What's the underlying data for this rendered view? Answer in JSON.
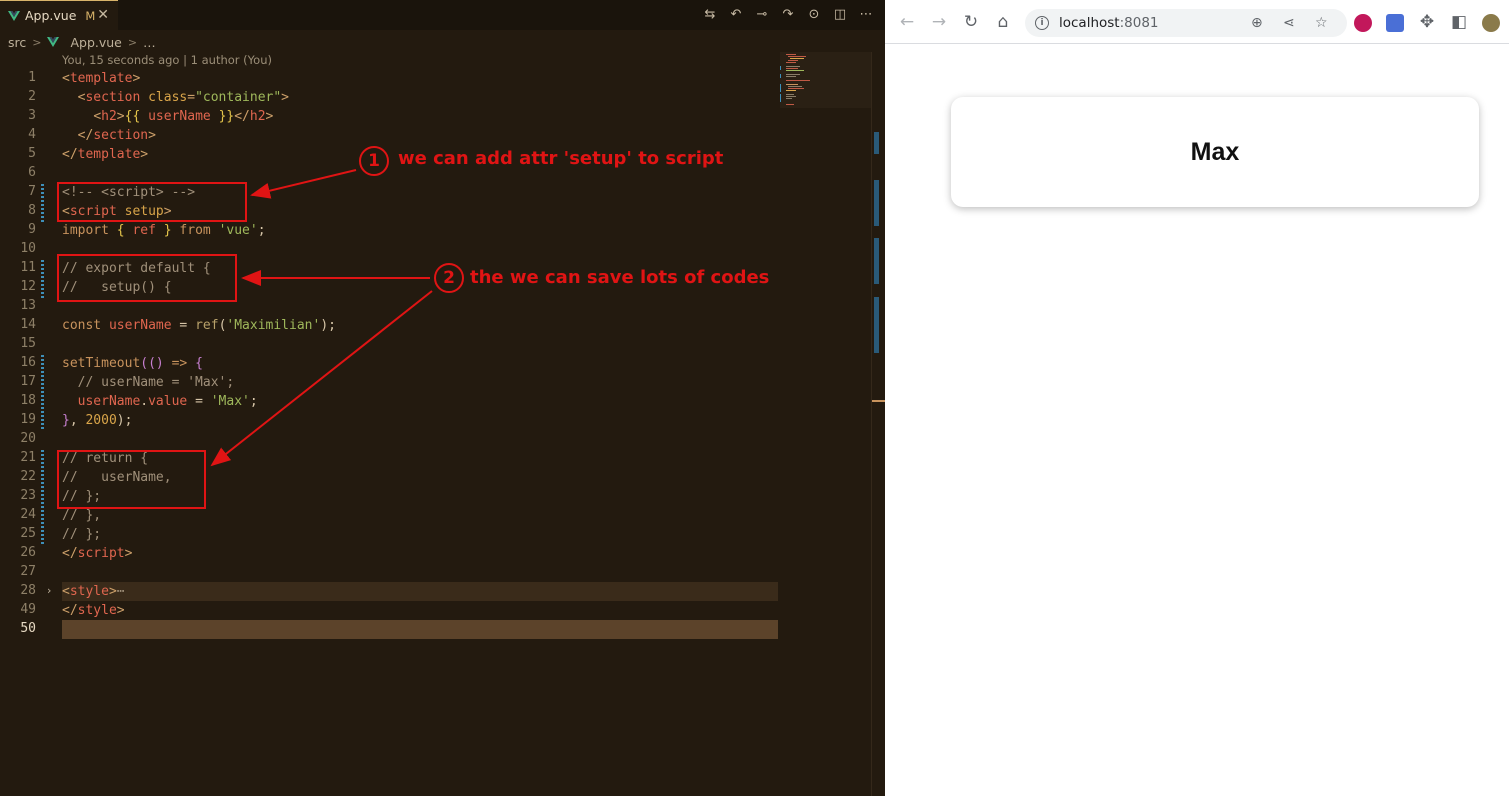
{
  "editor": {
    "tab": {
      "filename": "App.vue",
      "status": "M"
    },
    "toolbar_icons": [
      "source-control-icon",
      "go-back-icon",
      "commit-icon",
      "go-forward-icon",
      "timeline-icon",
      "split-editor-icon",
      "more-icon"
    ],
    "breadcrumb": {
      "folder": "src",
      "file": "App.vue",
      "ellipsis": "…"
    },
    "blame": "You, 15 seconds ago | 1 author (You)",
    "line_numbers": [
      "1",
      "2",
      "3",
      "4",
      "5",
      "6",
      "7",
      "8",
      "9",
      "10",
      "11",
      "12",
      "13",
      "14",
      "15",
      "16",
      "17",
      "18",
      "19",
      "20",
      "21",
      "22",
      "23",
      "24",
      "25",
      "26",
      "27",
      "28",
      "49",
      "50"
    ],
    "active_line": "50"
  },
  "annotations": {
    "one": {
      "number": "1",
      "text": "we can add attr 'setup' to script"
    },
    "two": {
      "number": "2",
      "text": "the we can save lots of codes"
    },
    "color": "#e01414"
  },
  "browser": {
    "url_host": "localhost",
    "url_port": ":8081",
    "page_heading": "Max"
  },
  "colors": {
    "editor_bg": "#231a0f",
    "accent": "#d9b46a",
    "annotation": "#e01414"
  }
}
